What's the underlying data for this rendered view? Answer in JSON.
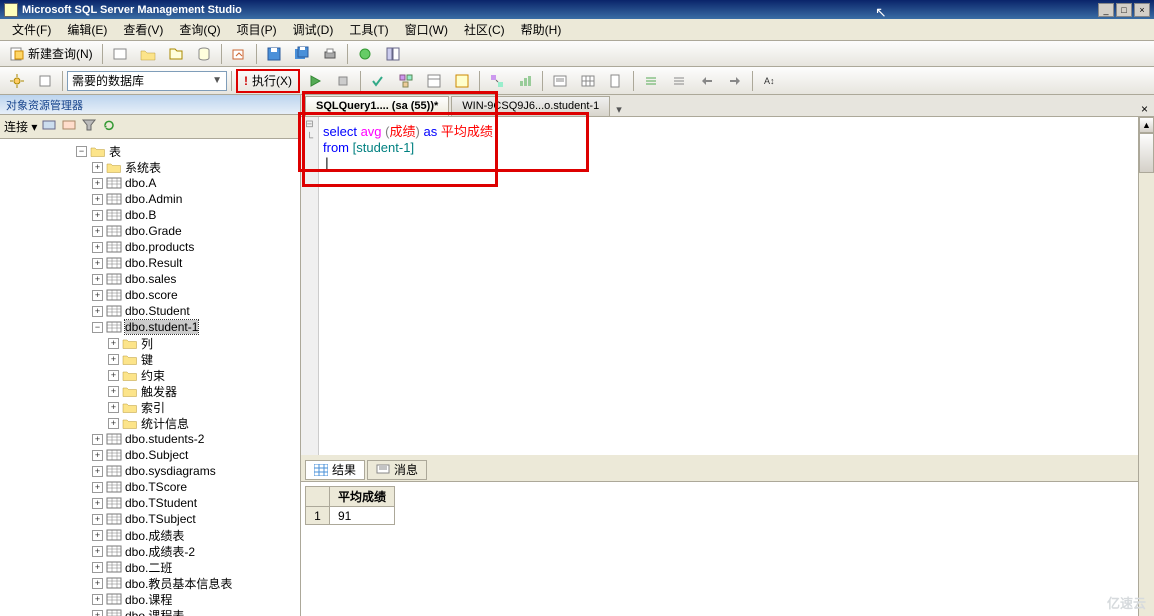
{
  "title": "Microsoft SQL Server Management Studio",
  "menubar": [
    "文件(F)",
    "编辑(E)",
    "查看(V)",
    "查询(Q)",
    "项目(P)",
    "调试(D)",
    "工具(T)",
    "窗口(W)",
    "社区(C)",
    "帮助(H)"
  ],
  "toolbar1": {
    "new_query": "新建查询(N)"
  },
  "toolbar2": {
    "db_selected": "需要的数据库",
    "execute": "执行(X)"
  },
  "objexp": {
    "title": "对象资源管理器",
    "connect": "连接 ▾"
  },
  "tree": {
    "root": "表",
    "sysTables": "系统表",
    "tables": [
      "dbo.A",
      "dbo.Admin",
      "dbo.B",
      "dbo.Grade",
      "dbo.products",
      "dbo.Result",
      "dbo.sales",
      "dbo.score",
      "dbo.Student",
      "dbo.student-1"
    ],
    "student1_children": [
      "列",
      "键",
      "约束",
      "触发器",
      "索引",
      "统计信息"
    ],
    "tables_after": [
      "dbo.students-2",
      "dbo.Subject",
      "dbo.sysdiagrams",
      "dbo.TScore",
      "dbo.TStudent",
      "dbo.TSubject",
      "dbo.成绩表",
      "dbo.成绩表-2",
      "dbo.二班",
      "dbo.教员基本信息表",
      "dbo.课程",
      "dbo.课程表"
    ]
  },
  "tabs": {
    "active": "SQLQuery1.... (sa (55))*",
    "inactive": "WIN-9CSQ9J6...o.student-1"
  },
  "sql": {
    "line1_select": "select ",
    "line1_avg": "avg",
    "line1_paren_open": " (",
    "line1_col": "成绩",
    "line1_paren_close": ") ",
    "line1_as": "as ",
    "line1_alias": "平均成绩",
    "line2_from": "from ",
    "line2_table": "[student-1]"
  },
  "result_tabs": {
    "results": "结果",
    "messages": "消息"
  },
  "result_grid": {
    "header": "平均成绩",
    "row1_num": "1",
    "row1_val": "91"
  },
  "watermark": "亿速云"
}
